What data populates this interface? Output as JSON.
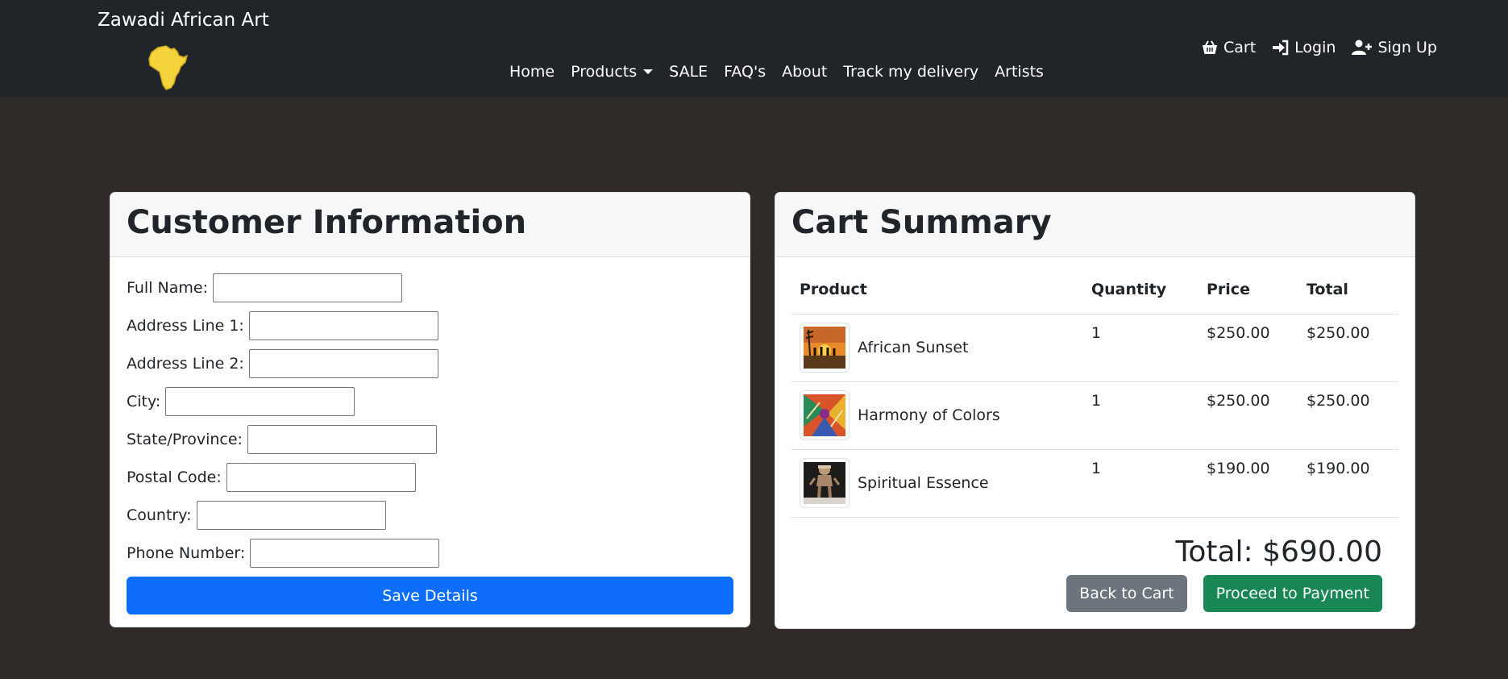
{
  "navbar": {
    "brand": "Zawadi African Art",
    "links": [
      {
        "label": "Home"
      },
      {
        "label": "Products"
      },
      {
        "label": "SALE"
      },
      {
        "label": "FAQ's"
      },
      {
        "label": "About"
      },
      {
        "label": "Track my delivery"
      },
      {
        "label": "Artists"
      }
    ],
    "right": {
      "cart": "Cart",
      "login": "Login",
      "signup": "Sign Up"
    }
  },
  "customer": {
    "title": "Customer Information",
    "fields": [
      {
        "label": "Full Name:",
        "value": ""
      },
      {
        "label": "Address Line 1:",
        "value": ""
      },
      {
        "label": "Address Line 2:",
        "value": ""
      },
      {
        "label": "City:",
        "value": ""
      },
      {
        "label": "State/Province:",
        "value": ""
      },
      {
        "label": "Postal Code:",
        "value": ""
      },
      {
        "label": "Country:",
        "value": ""
      },
      {
        "label": "Phone Number:",
        "value": ""
      }
    ],
    "save_label": "Save Details"
  },
  "cart": {
    "title": "Cart Summary",
    "columns": [
      "Product",
      "Quantity",
      "Price",
      "Total"
    ],
    "rows": [
      {
        "product": "African Sunset",
        "quantity": "1",
        "price": "$250.00",
        "total": "$250.00"
      },
      {
        "product": "Harmony of Colors",
        "quantity": "1",
        "price": "$250.00",
        "total": "$250.00"
      },
      {
        "product": "Spiritual Essence",
        "quantity": "1",
        "price": "$190.00",
        "total": "$190.00"
      }
    ],
    "grand_total": "Total: $690.00",
    "back_label": "Back to Cart",
    "proceed_label": "Proceed to Payment"
  },
  "colors": {
    "navbar": "#212529",
    "background": "#302b29",
    "primary": "#0d6efd",
    "secondary": "#6c757d",
    "success": "#198754",
    "logo": "#f5d33c"
  }
}
